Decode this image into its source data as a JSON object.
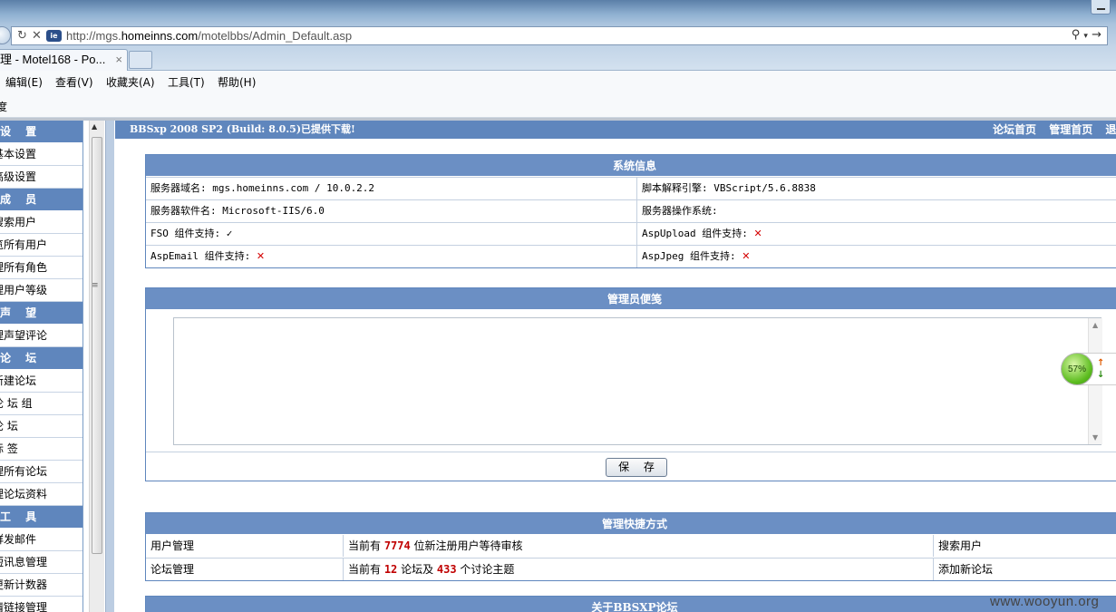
{
  "browser": {
    "url_prefix": "http://mgs.",
    "url_domain": "homeinns.com",
    "url_path": "/motelbbs/Admin_Default.asp",
    "tab_title": "理 - Motel168 - Po...",
    "tab_close": "×",
    "menu": [
      "编辑(E)",
      "查看(V)",
      "收藏夹(A)",
      "工具(T)",
      "帮助(H)"
    ],
    "favorites_fragment": "度",
    "icons": [
      "refresh-icon",
      "stop-icon",
      "ie-compat-icon",
      "search-icon",
      "go-icon"
    ]
  },
  "sidebar": {
    "items": [
      {
        "label": "设  置",
        "header": true
      },
      {
        "label": "基本设置"
      },
      {
        "label": "高级设置"
      },
      {
        "label": "成  员",
        "header": true
      },
      {
        "label": "搜索用户"
      },
      {
        "label": "览所有用户"
      },
      {
        "label": "理所有角色"
      },
      {
        "label": "理用户等级"
      },
      {
        "label": "声  望",
        "header": true
      },
      {
        "label": "理声望评论"
      },
      {
        "label": "论  坛",
        "header": true
      },
      {
        "label": "新建论坛"
      },
      {
        "label": "论 坛 组"
      },
      {
        "label": "论    坛"
      },
      {
        "label": "标    签"
      },
      {
        "label": "理所有论坛"
      },
      {
        "label": "理论坛资料"
      },
      {
        "label": "工  具",
        "header": true
      },
      {
        "label": "群发邮件"
      },
      {
        "label": "短讯息管理"
      },
      {
        "label": "更新计数器"
      },
      {
        "label": "情链接管理"
      }
    ]
  },
  "topbar": {
    "news": "BBSxp 2008 SP2 (Build: 8.0.5)已提供下载!",
    "links": [
      "论坛首页",
      "管理首页",
      "退"
    ]
  },
  "system_info": {
    "title": "系统信息",
    "rows": [
      {
        "left": "服务器域名: mgs.homeinns.com / 10.0.2.2",
        "right": "脚本解释引擎: VBScript/5.6.8838"
      },
      {
        "left": "服务器软件名: Microsoft-IIS/6.0",
        "right": "服务器操作系统:"
      },
      {
        "left": "FSO 组件支持: ",
        "left_mark": "✓",
        "right": "AspUpload 组件支持: ",
        "right_mark": "✕"
      },
      {
        "left": "AspEmail 组件支持: ",
        "left_mark": "✕",
        "right": "AspJpeg 组件支持: ",
        "right_mark": "✕"
      }
    ]
  },
  "admin_notes": {
    "title": "管理员便笺",
    "content": "",
    "save_label": "保 存"
  },
  "quick_links": {
    "title": "管理快捷方式",
    "rows": [
      {
        "name": "用户管理",
        "pre": "当前有 ",
        "n1": "7774",
        "mid": " 位新注册用户等待审核",
        "n2": "",
        "post": "",
        "action": "搜索用户"
      },
      {
        "name": "论坛管理",
        "pre": "当前有 ",
        "n1": "12",
        "mid": " 论坛及 ",
        "n2": "433",
        "post": " 个讨论主题",
        "action": "添加新论坛"
      }
    ]
  },
  "about": {
    "title": "关于BBSXP论坛"
  },
  "widget": {
    "percent": "57%",
    "up": "↑",
    "down": "↓"
  },
  "watermark": "www.wooyun.org",
  "colors": {
    "header_blue": "#5f86bd",
    "panel_head": "#6b8fc4",
    "accent_red": "#c00000"
  }
}
